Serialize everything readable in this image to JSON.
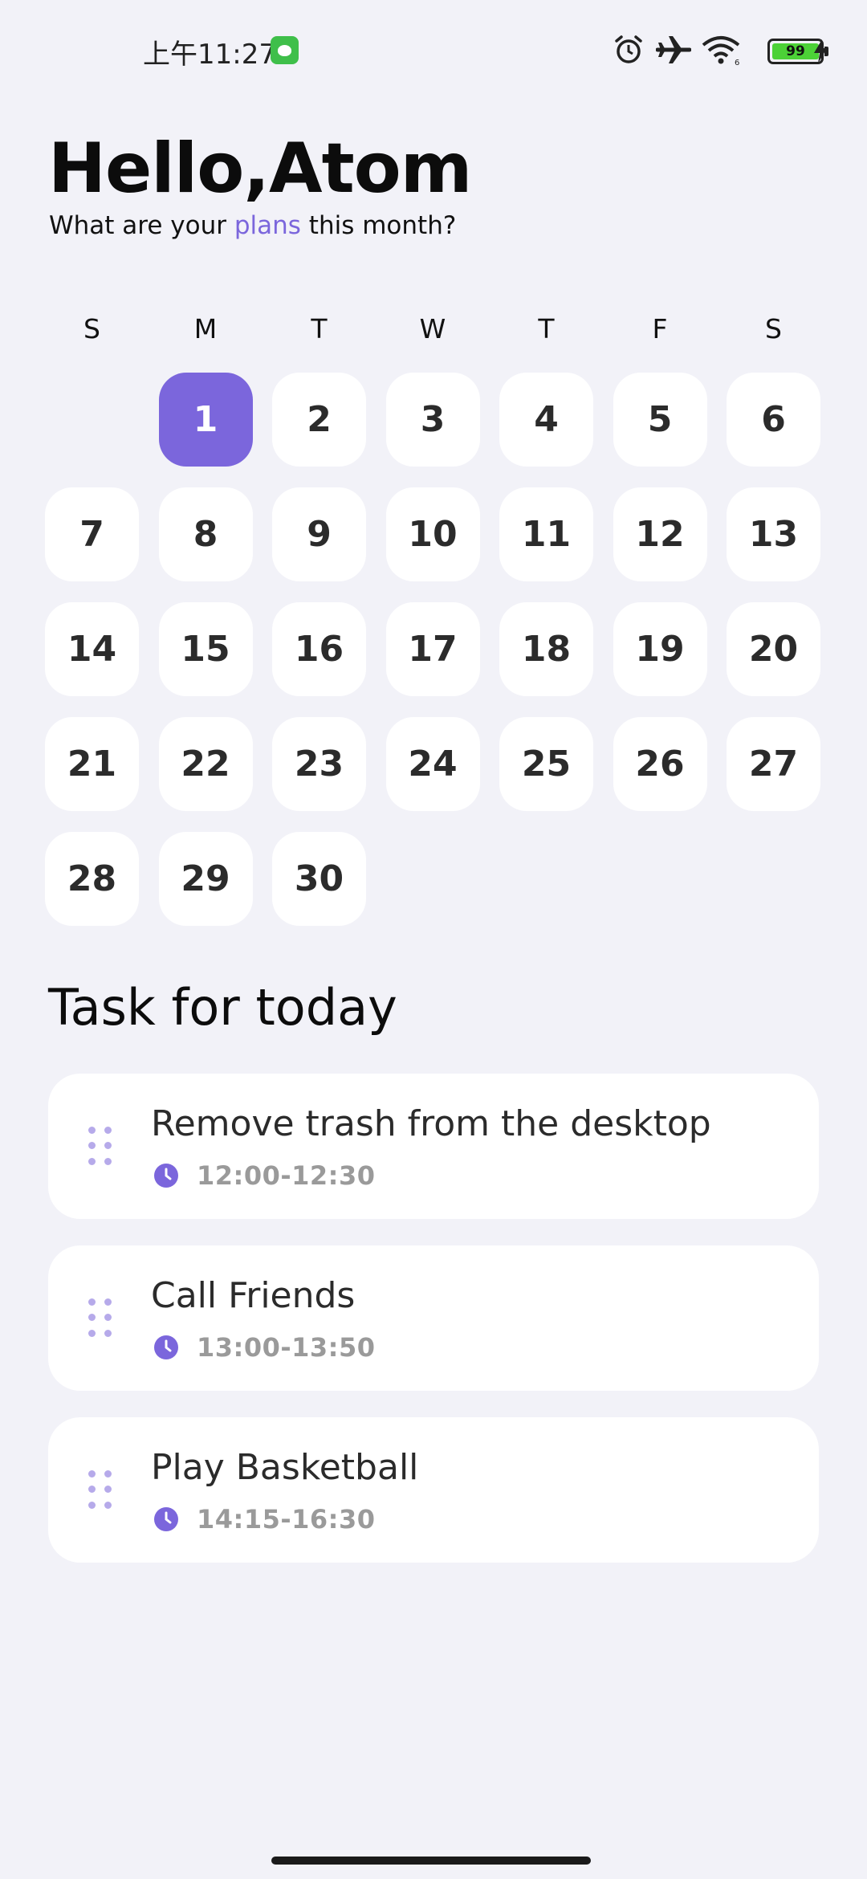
{
  "status_bar": {
    "time": "上午11:27",
    "battery_level": "99",
    "icons": [
      "alarm-icon",
      "airplane-icon",
      "wifi-icon",
      "battery-icon",
      "charging-icon"
    ]
  },
  "header": {
    "greeting": "Hello,Atom",
    "subtitle_pre": "What are your ",
    "subtitle_accent": "plans",
    "subtitle_post": " this month?"
  },
  "calendar": {
    "weekdays": [
      "S",
      "M",
      "T",
      "W",
      "T",
      "F",
      "S"
    ],
    "leading_empty": 1,
    "days": [
      "1",
      "2",
      "3",
      "4",
      "5",
      "6",
      "7",
      "8",
      "9",
      "10",
      "11",
      "12",
      "13",
      "14",
      "15",
      "16",
      "17",
      "18",
      "19",
      "20",
      "21",
      "22",
      "23",
      "24",
      "25",
      "26",
      "27",
      "28",
      "29",
      "30"
    ],
    "selected": "1"
  },
  "tasks": {
    "title": "Task for today",
    "items": [
      {
        "title": "Remove trash from the desktop",
        "time": "12:00-12:30"
      },
      {
        "title": "Call Friends",
        "time": "13:00-13:50"
      },
      {
        "title": "Play Basketball",
        "time": "14:15-16:30"
      }
    ]
  },
  "colors": {
    "accent": "#7b66dc",
    "background": "#f2f2f8",
    "card": "#ffffff",
    "battery": "#4cd137"
  }
}
